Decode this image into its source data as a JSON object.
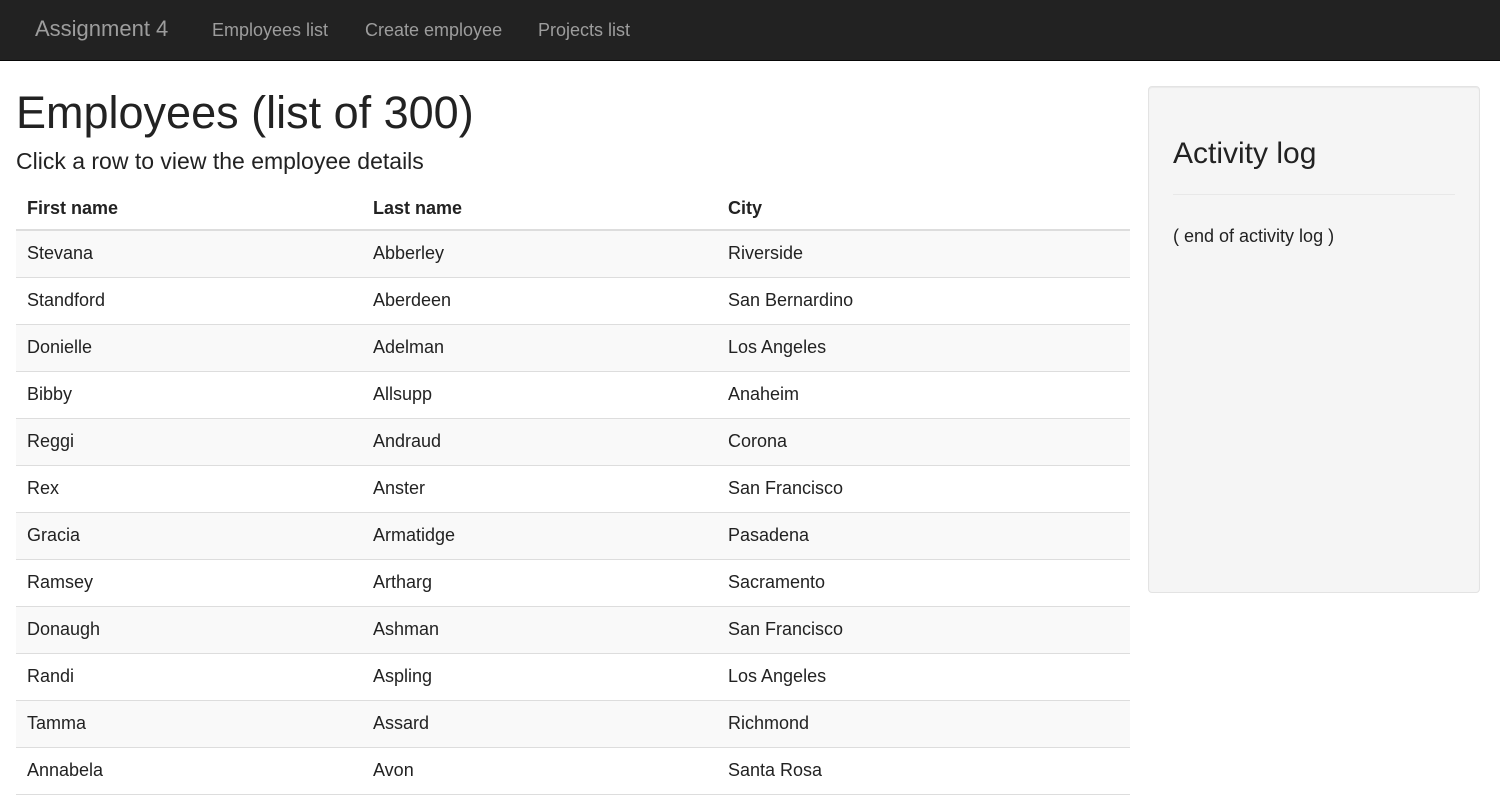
{
  "navbar": {
    "brand": "Assignment 4",
    "links": [
      "Employees list",
      "Create employee",
      "Projects list"
    ]
  },
  "main": {
    "title": "Employees (list of 300)",
    "subtitle": "Click a row to view the employee details",
    "table": {
      "headers": [
        "First name",
        "Last name",
        "City"
      ],
      "rows": [
        [
          "Stevana",
          "Abberley",
          "Riverside"
        ],
        [
          "Standford",
          "Aberdeen",
          "San Bernardino"
        ],
        [
          "Donielle",
          "Adelman",
          "Los Angeles"
        ],
        [
          "Bibby",
          "Allsupp",
          "Anaheim"
        ],
        [
          "Reggi",
          "Andraud",
          "Corona"
        ],
        [
          "Rex",
          "Anster",
          "San Francisco"
        ],
        [
          "Gracia",
          "Armatidge",
          "Pasadena"
        ],
        [
          "Ramsey",
          "Artharg",
          "Sacramento"
        ],
        [
          "Donaugh",
          "Ashman",
          "San Francisco"
        ],
        [
          "Randi",
          "Aspling",
          "Los Angeles"
        ],
        [
          "Tamma",
          "Assard",
          "Richmond"
        ],
        [
          "Annabela",
          "Avon",
          "Santa Rosa"
        ]
      ]
    }
  },
  "activity_log": {
    "title": "Activity log",
    "end_text": "( end of activity log )"
  },
  "colors": {
    "navbar_bg": "#222222",
    "nav_text": "#9d9d9d",
    "stripe": "#f9f9f9",
    "panel_bg": "#f5f5f5"
  }
}
